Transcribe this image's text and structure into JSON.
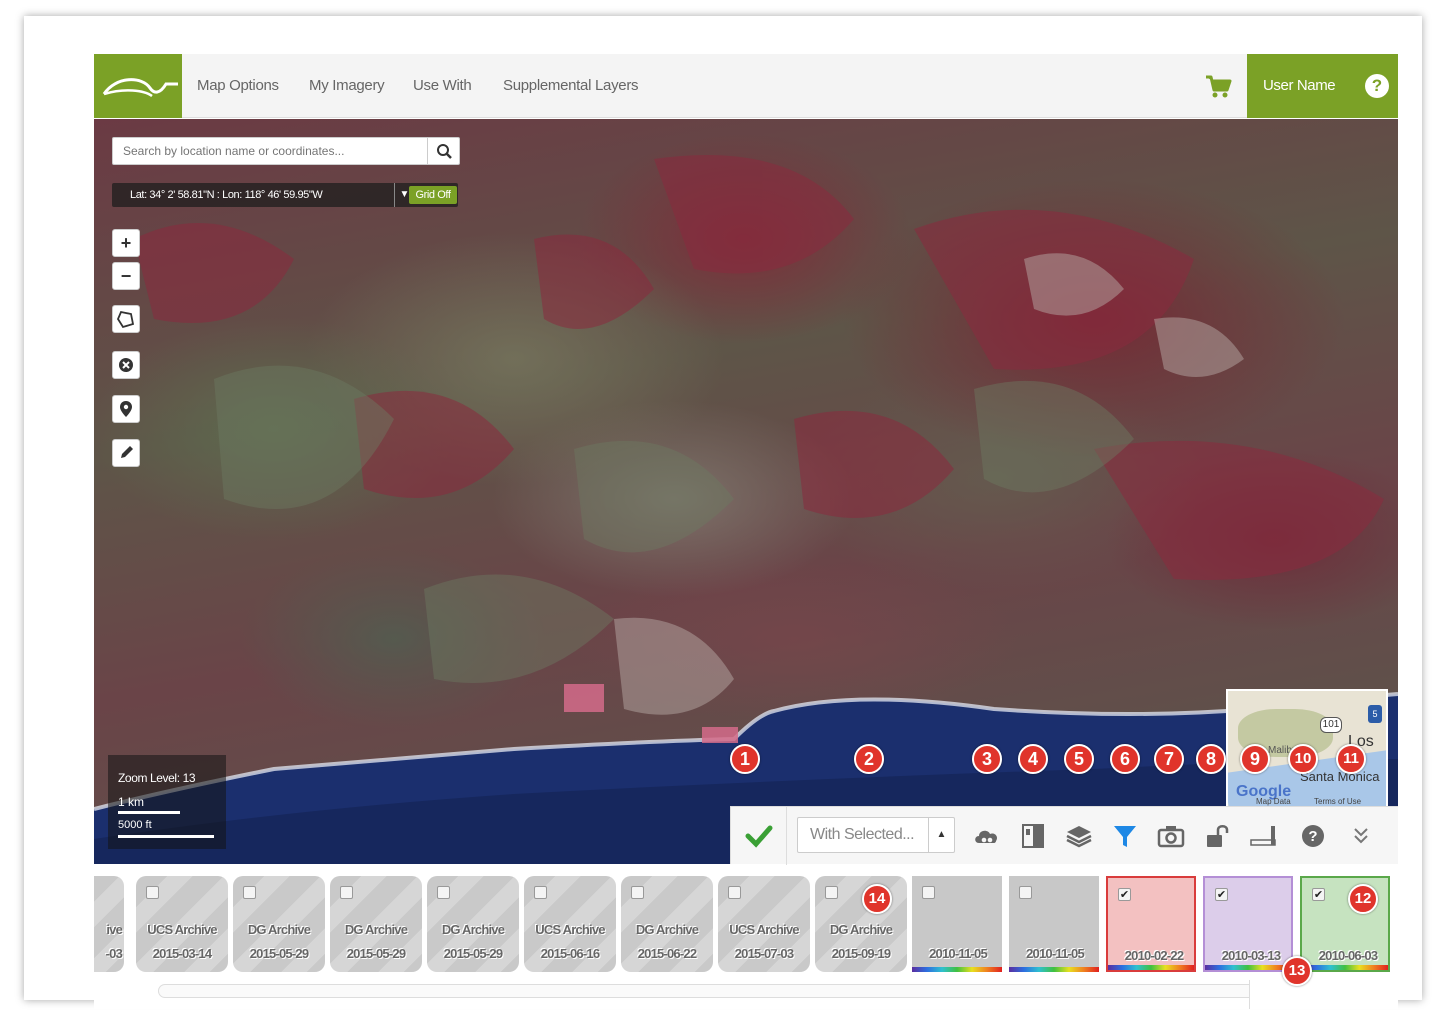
{
  "nav": {
    "items": [
      "Map Options",
      "My Imagery",
      "Use With",
      "Supplemental Layers"
    ],
    "user_name": "User Name",
    "help": "?"
  },
  "map": {
    "search_placeholder": "Search by location name or coordinates...",
    "coordinates": "Lat: 34° 2' 58.81\"N : Lon: 118° 46' 59.95\"W",
    "grid_button": "Grid Off",
    "zoom_in": "+",
    "zoom_out": "−",
    "zoom_level": "Zoom Level: 13",
    "scale_km": "1 km",
    "scale_ft": "5000 ft",
    "minimap": {
      "los": "Los",
      "santa_monica": "Santa Monica",
      "malibu": "Malibu",
      "highway": "101",
      "google": "Google",
      "map_data": "Map Data",
      "terms": "Terms of Use"
    }
  },
  "toolbar": {
    "with_selected": "With Selected...",
    "icons": [
      "checkmark-icon",
      "cloud-icon",
      "split-view-icon",
      "layers-icon",
      "filter-icon",
      "camera-icon",
      "unlock-icon",
      "slider-icon",
      "help-icon",
      "collapse-icon"
    ]
  },
  "markers": [
    "1",
    "2",
    "3",
    "4",
    "5",
    "6",
    "7",
    "8",
    "9",
    "10",
    "11",
    "12",
    "13",
    "14"
  ],
  "thumbnails": [
    {
      "line1": "ive",
      "line2": "-03",
      "checked": false,
      "style": "partial"
    },
    {
      "line1": "UCS Archive",
      "line2": "2015-03-14",
      "checked": false,
      "style": "striped"
    },
    {
      "line1": "DG Archive",
      "line2": "2015-05-29",
      "checked": false,
      "style": "striped"
    },
    {
      "line1": "DG Archive",
      "line2": "2015-05-29",
      "checked": false,
      "style": "striped"
    },
    {
      "line1": "DG Archive",
      "line2": "2015-05-29",
      "checked": false,
      "style": "striped"
    },
    {
      "line1": "UCS Archive",
      "line2": "2015-06-16",
      "checked": false,
      "style": "striped"
    },
    {
      "line1": "DG Archive",
      "line2": "2015-06-22",
      "checked": false,
      "style": "striped"
    },
    {
      "line1": "UCS Archive",
      "line2": "2015-07-03",
      "checked": false,
      "style": "striped"
    },
    {
      "line1": "DG Archive",
      "line2": "2015-09-19",
      "checked": false,
      "style": "striped"
    },
    {
      "line1": "",
      "line2": "2010-11-05",
      "checked": false,
      "style": "plain"
    },
    {
      "line1": "",
      "line2": "2010-11-05",
      "checked": false,
      "style": "plain"
    },
    {
      "line1": "",
      "line2": "2010-02-22",
      "checked": true,
      "style": "red"
    },
    {
      "line1": "",
      "line2": "2010-03-13",
      "checked": true,
      "style": "purple"
    },
    {
      "line1": "",
      "line2": "2010-06-03",
      "checked": true,
      "style": "green"
    }
  ],
  "colors": {
    "brand_green": "#7ba126",
    "marker_red": "#e0342b",
    "filter_blue": "#1e88e5"
  }
}
